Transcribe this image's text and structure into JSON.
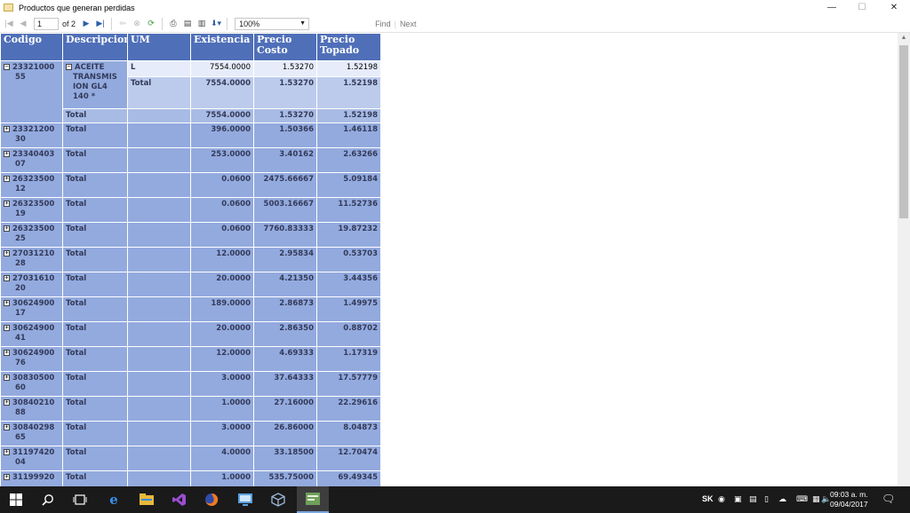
{
  "window": {
    "title": "Productos que generan perdidas",
    "minimize": "—",
    "maximize": "☐",
    "close": "✕"
  },
  "toolbar": {
    "page_current": "1",
    "page_of": "of 2",
    "zoom": "100%",
    "find_label": "Find",
    "next_label": "Next"
  },
  "columns": [
    "Codigo",
    "Descripcion",
    "UM",
    "Existencia",
    "Precio Costo",
    "Precio Topado"
  ],
  "group1": {
    "code": "2332100055",
    "code_line1": "23321000",
    "code_line2": "55",
    "desc": "ACEITE TRANSMISION GL4 140 *",
    "desc_lines": [
      "ACEITE",
      "TRANSMIS",
      "ION GL4",
      "140 *"
    ],
    "detail": {
      "um": "L",
      "existencia": "7554.0000",
      "costo": "1.53270",
      "topado": "1.52198"
    },
    "subtotal": {
      "label": "Total",
      "existencia": "7554.0000",
      "costo": "1.53270",
      "topado": "1.52198"
    },
    "total": {
      "label": "Total",
      "existencia": "7554.0000",
      "costo": "1.53270",
      "topado": "1.52198"
    }
  },
  "rows": [
    {
      "c1": "23321200",
      "c2": "30",
      "label": "Total",
      "existencia": "396.0000",
      "costo": "1.50366",
      "topado": "1.46118"
    },
    {
      "c1": "23340403",
      "c2": "07",
      "label": "Total",
      "existencia": "253.0000",
      "costo": "3.40162",
      "topado": "2.63266"
    },
    {
      "c1": "26323500",
      "c2": "12",
      "label": "Total",
      "existencia": "0.0600",
      "costo": "2475.66667",
      "topado": "5.09184"
    },
    {
      "c1": "26323500",
      "c2": "19",
      "label": "Total",
      "existencia": "0.0600",
      "costo": "5003.16667",
      "topado": "11.52736"
    },
    {
      "c1": "26323500",
      "c2": "25",
      "label": "Total",
      "existencia": "0.0600",
      "costo": "7760.83333",
      "topado": "19.87232"
    },
    {
      "c1": "27031210",
      "c2": "28",
      "label": "Total",
      "existencia": "12.0000",
      "costo": "2.95834",
      "topado": "0.53703"
    },
    {
      "c1": "27031610",
      "c2": "20",
      "label": "Total",
      "existencia": "20.0000",
      "costo": "4.21350",
      "topado": "3.44356"
    },
    {
      "c1": "30624900",
      "c2": "17",
      "label": "Total",
      "existencia": "189.0000",
      "costo": "2.86873",
      "topado": "1.49975"
    },
    {
      "c1": "30624900",
      "c2": "41",
      "label": "Total",
      "existencia": "20.0000",
      "costo": "2.86350",
      "topado": "0.88702"
    },
    {
      "c1": "30624900",
      "c2": "76",
      "label": "Total",
      "existencia": "12.0000",
      "costo": "4.69333",
      "topado": "1.17319"
    },
    {
      "c1": "30830500",
      "c2": "60",
      "label": "Total",
      "existencia": "3.0000",
      "costo": "37.64333",
      "topado": "17.57779"
    },
    {
      "c1": "30840210",
      "c2": "88",
      "label": "Total",
      "existencia": "1.0000",
      "costo": "27.16000",
      "topado": "22.29616"
    },
    {
      "c1": "30840298",
      "c2": "65",
      "label": "Total",
      "existencia": "3.0000",
      "costo": "26.86000",
      "topado": "8.04873"
    },
    {
      "c1": "31197420",
      "c2": "04",
      "label": "Total",
      "existencia": "4.0000",
      "costo": "33.18500",
      "topado": "12.70474"
    },
    {
      "c1": "31199920",
      "c2": "",
      "label": "Total",
      "existencia": "1.0000",
      "costo": "535.75000",
      "topado": "69.49345"
    }
  ],
  "taskbar": {
    "time": "09:03 a. m.",
    "date": "09/04/2017",
    "icons": [
      "windows-start-icon",
      "search-icon",
      "task-view-icon",
      "edge-icon",
      "file-explorer-icon",
      "visual-studio-icon",
      "firefox-icon",
      "remote-desktop-icon",
      "virtualbox-icon",
      "report-app-icon"
    ]
  }
}
